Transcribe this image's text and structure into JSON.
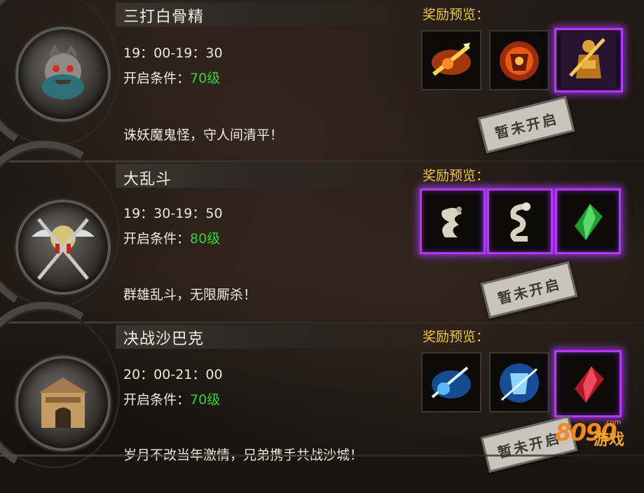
{
  "events": [
    {
      "title": "三打白骨精",
      "time": "19：00-19：30",
      "condition_label": "开启条件：",
      "level": "70级",
      "description": "诛妖魔鬼怪，守人间清平！",
      "reward_label": "奖励预览：",
      "stamp": "暂未开启",
      "emblem_icon": "demon-skull-icon",
      "rewards": [
        {
          "icon": "flame-spear-icon",
          "quality": "normal"
        },
        {
          "icon": "flame-armor-icon",
          "quality": "normal"
        },
        {
          "icon": "golden-warrior-icon",
          "quality": "purple"
        }
      ]
    },
    {
      "title": "大乱斗",
      "time": "19：30-19：50",
      "condition_label": "开启条件：",
      "level": "80级",
      "description": "群雄乱斗，无限厮杀！",
      "reward_label": "奖励预览：",
      "stamp": "暂未开启",
      "emblem_icon": "crossed-swords-icon",
      "rewards": [
        {
          "icon": "dragon-statue-icon",
          "quality": "purple"
        },
        {
          "icon": "serpent-statue-icon",
          "quality": "purple"
        },
        {
          "icon": "green-gem-icon",
          "quality": "purple"
        }
      ]
    },
    {
      "title": "决战沙巴克",
      "time": "20：00-21：00",
      "condition_label": "开启条件：",
      "level": "70级",
      "description": "岁月不改当年激情，兄弟携手共战沙城！",
      "reward_label": "奖励预览：",
      "stamp": "暂未开启",
      "emblem_icon": "fortress-gate-icon",
      "rewards": [
        {
          "icon": "ice-spear-icon",
          "quality": "normal"
        },
        {
          "icon": "ice-armor-icon",
          "quality": "normal"
        },
        {
          "icon": "red-gem-icon",
          "quality": "purple"
        }
      ]
    }
  ],
  "watermark": {
    "number": "8090",
    "domain": ".com",
    "text": "游戏"
  },
  "colors": {
    "level": "#38d33a",
    "reward_label": "#f0c84a",
    "purple_glow": "#b637ff"
  }
}
